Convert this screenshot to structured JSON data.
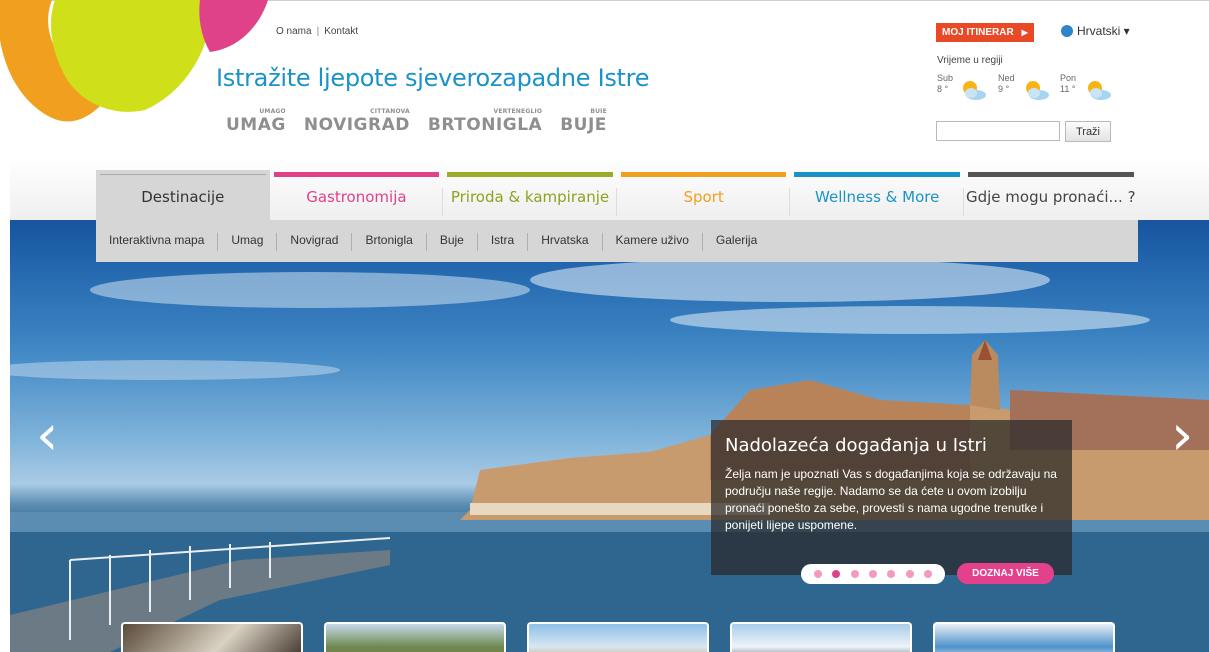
{
  "toplinks": {
    "about": "O nama",
    "sep": "|",
    "contact": "Kontakt"
  },
  "tagline": "Istražite ljepote sjeverozapadne Istre",
  "towns": [
    {
      "small": "UMAGO",
      "big": "UMAG"
    },
    {
      "small": "CITTANOVA",
      "big": "NOVIGRAD"
    },
    {
      "small": "VERTENEGLIO",
      "big": "BRTONIGLA"
    },
    {
      "small": "BUIE",
      "big": "BUJE"
    }
  ],
  "itinerary": {
    "label": "MOJ ITINERAR",
    "arrow": "▶"
  },
  "language": {
    "label": "Hrvatski ▾"
  },
  "weather": {
    "title": "Vrijeme u regiji",
    "days": [
      {
        "day": "Sub",
        "temp": "8 °"
      },
      {
        "day": "Ned",
        "temp": "9 °"
      },
      {
        "day": "Pon",
        "temp": "11 °"
      }
    ]
  },
  "search": {
    "placeholder": "",
    "button": "Traži"
  },
  "nav": {
    "tabs": [
      {
        "label": "Destinacije",
        "color": "#aaaaaa",
        "text_color": "#333333"
      },
      {
        "label": "Gastronomija",
        "color": "#e0428a",
        "text_color": "#e0428a"
      },
      {
        "label": "Priroda & kampiranje",
        "color": "#9aac2a",
        "text_color": "#8ca31f"
      },
      {
        "label": "Sport",
        "color": "#f0a01e",
        "text_color": "#f0a01e"
      },
      {
        "label": "Wellness & More",
        "color": "#1a93c9",
        "text_color": "#1a93c9"
      },
      {
        "label": "Gdje mogu pronaći... ?",
        "color": "#555555",
        "text_color": "#444444"
      }
    ],
    "subnav": [
      "Interaktivna mapa",
      "Umag",
      "Novigrad",
      "Brtonigla",
      "Buje",
      "Istra",
      "Hrvatska",
      "Kamere uživo",
      "Galerija"
    ]
  },
  "slider": {
    "prev": "‹",
    "next": "›",
    "title": "Nadolazeća događanja u Istri",
    "text": "Želja nam je upoznati Vas s događanjima koja se održavaju na području naše regije. Nadamo se da ćete u ovom izobilju pronaći ponešto za sebe, provesti s nama ugodne trenutke i ponijeti lijepe uspomene.",
    "dots_total": 7,
    "dots_active": 2,
    "more": "DOZNAJ VIŠE"
  },
  "colors": {
    "accent": "#1a93c9",
    "pink": "#e0428a",
    "orange": "#e84a27"
  }
}
